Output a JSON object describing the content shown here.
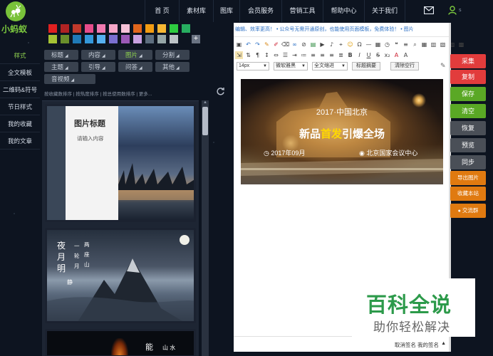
{
  "app": {
    "logo_text": "小蚂蚁"
  },
  "nav": {
    "items": [
      "首 页",
      "素材库",
      "图库",
      "会员服务",
      "营销工具",
      "帮助中心",
      "关于我们"
    ],
    "user_name": "s"
  },
  "sidebar": {
    "items": [
      "样式",
      "全文模板",
      "二维码&符号",
      "节日样式",
      "我的收藏",
      "我的文章"
    ],
    "active": "样式"
  },
  "palette": {
    "row1": [
      "#e02020",
      "#b02323",
      "#c0392b",
      "#e74c8b",
      "#f07ab0",
      "#f5a6c8",
      "#f6c2d8",
      "#e0661c",
      "#f39c12",
      "#f7b733",
      "#2ecc40",
      "#27ae60"
    ],
    "row2": [
      "#a5c234",
      "#6a8f2b",
      "#1f7ab8",
      "#3498db",
      "#56b0f0",
      "#7a6fd0",
      "#9b59b6",
      "#c9a1e0",
      "#5d6d7e",
      "#95a5a6",
      "#bdc3c7",
      "#2c3e50"
    ],
    "plus": "+"
  },
  "categories": [
    {
      "label": "标题",
      "active": false
    },
    {
      "label": "内容",
      "active": false
    },
    {
      "label": "图片",
      "active": true
    },
    {
      "label": "分割",
      "active": false
    },
    {
      "label": "主题",
      "active": false
    },
    {
      "label": "引导",
      "active": false
    },
    {
      "label": "问答",
      "active": false
    },
    {
      "label": "其他",
      "active": false
    },
    {
      "label": "音视频",
      "active": false
    }
  ],
  "sort_bar": "按收藏数排序 | 按热度排序 | 按总使用数排序 | 更多...",
  "templates": {
    "card1": {
      "title": "图片标题",
      "subtitle": "请输入内容"
    },
    "card2": {
      "title": "夜月明",
      "poem_col1": "一轮月",
      "poem_col2": "两座山",
      "tail": "静"
    },
    "card3": {
      "text1": "能",
      "text2": "山 水"
    }
  },
  "editor": {
    "marquee": "编辑、效率更高！ • 公众号无需开通原创，也能使用页面模板，免费体验！ • 图片",
    "font_size": "14px",
    "font_family": "微软雅黑",
    "indent": "全文缩进",
    "btn_summary": "标题摘要",
    "btn_clear": "清除空行",
    "banner": {
      "line1": "2017·中国北京",
      "line2_a": "新品",
      "line2_b": "首发",
      "line2_c": "引爆全场",
      "date": "2017年09月",
      "venue": "北京国家会议中心"
    },
    "footer": "取消签名 我的签名"
  },
  "actions": [
    {
      "label": "采集",
      "color": "#e23c3c"
    },
    {
      "label": "复制",
      "color": "#e23c3c"
    },
    {
      "label": "保存",
      "color": "#5aa825"
    },
    {
      "label": "清空",
      "color": "#5aa825"
    },
    {
      "label": "恢复",
      "color": "#4a4f57"
    },
    {
      "label": "预览",
      "color": "#4a4f57"
    },
    {
      "label": "同步",
      "color": "#4a4f57"
    },
    {
      "label": "导出图片",
      "color": "#e07a10"
    },
    {
      "label": "收藏本站",
      "color": "#e07a10"
    },
    {
      "label": "交流群",
      "color": "#e07a10"
    }
  ],
  "watermark": {
    "title": "百科全说",
    "subtitle": "助你轻松解决"
  }
}
